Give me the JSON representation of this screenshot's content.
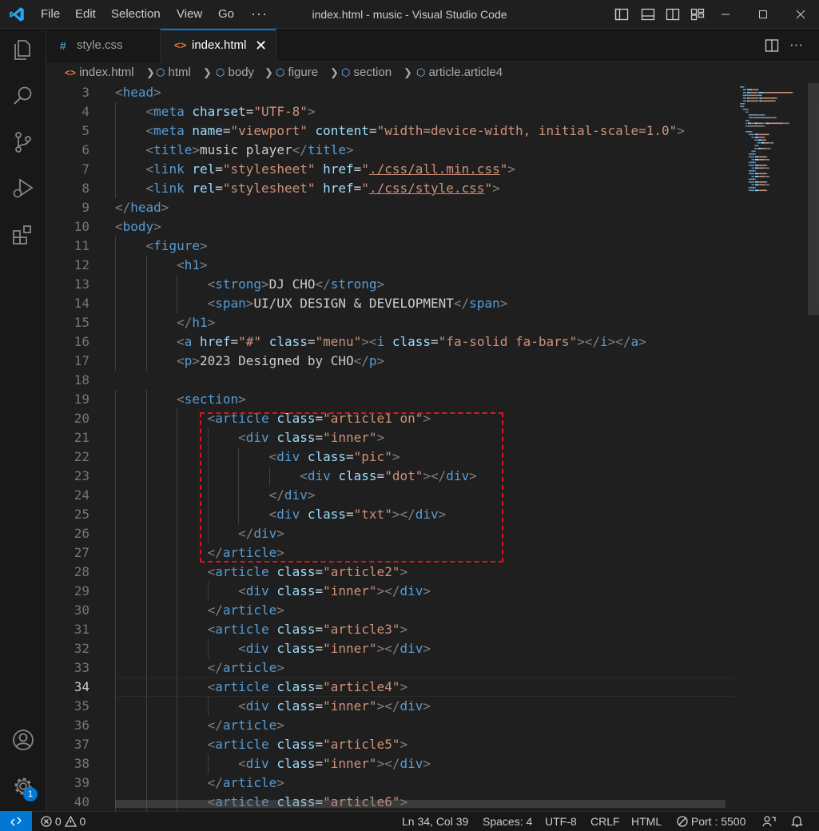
{
  "titlebar": {
    "menu": [
      "File",
      "Edit",
      "Selection",
      "View",
      "Go"
    ],
    "more": "···",
    "title": "index.html - music - Visual Studio Code"
  },
  "activity_bar": {
    "icons": [
      "explorer-icon",
      "search-icon",
      "source-control-icon",
      "run-debug-icon",
      "extensions-icon",
      "account-icon",
      "settings-gear-icon"
    ],
    "badge_count": "1",
    "accent_color": "#0078d4"
  },
  "tabs": [
    {
      "label": "style.css",
      "icon": "#",
      "active": false
    },
    {
      "label": "index.html",
      "icon": "<>",
      "active": true,
      "close": "✕"
    }
  ],
  "breadcrumb": [
    "index.html",
    "html",
    "body",
    "figure",
    "section",
    "article.article4"
  ],
  "editor": {
    "active_line": 34,
    "lines": [
      {
        "n": "3"
      },
      {
        "n": "4"
      },
      {
        "n": "5"
      },
      {
        "n": "6"
      },
      {
        "n": "7"
      },
      {
        "n": "8"
      },
      {
        "n": "9"
      },
      {
        "n": "10"
      },
      {
        "n": "11"
      },
      {
        "n": "12"
      },
      {
        "n": "13"
      },
      {
        "n": "14"
      },
      {
        "n": "15"
      },
      {
        "n": "16"
      },
      {
        "n": "17"
      },
      {
        "n": "18"
      },
      {
        "n": "19"
      },
      {
        "n": "20"
      },
      {
        "n": "21"
      },
      {
        "n": "22"
      },
      {
        "n": "23"
      },
      {
        "n": "24"
      },
      {
        "n": "25"
      },
      {
        "n": "26"
      },
      {
        "n": "27"
      },
      {
        "n": "28"
      },
      {
        "n": "29"
      },
      {
        "n": "30"
      },
      {
        "n": "31"
      },
      {
        "n": "32"
      },
      {
        "n": "33"
      },
      {
        "n": "34"
      },
      {
        "n": "35"
      },
      {
        "n": "36"
      },
      {
        "n": "37"
      },
      {
        "n": "38"
      },
      {
        "n": "39"
      },
      {
        "n": "40"
      }
    ],
    "code": [
      [
        [
          "p",
          "<"
        ],
        [
          "t",
          "head"
        ],
        [
          "p",
          ">"
        ]
      ],
      [
        [
          "x",
          "    "
        ],
        [
          "p",
          "<"
        ],
        [
          "t",
          "meta"
        ],
        [
          "x",
          " "
        ],
        [
          "a",
          "charset"
        ],
        [
          "x",
          "="
        ],
        [
          "s",
          "\"UTF-8\""
        ],
        [
          "p",
          ">"
        ]
      ],
      [
        [
          "x",
          "    "
        ],
        [
          "p",
          "<"
        ],
        [
          "t",
          "meta"
        ],
        [
          "x",
          " "
        ],
        [
          "a",
          "name"
        ],
        [
          "x",
          "="
        ],
        [
          "s",
          "\"viewport\""
        ],
        [
          "x",
          " "
        ],
        [
          "a",
          "content"
        ],
        [
          "x",
          "="
        ],
        [
          "s",
          "\"width=device-width, initial-scale=1.0\""
        ],
        [
          "p",
          ">"
        ]
      ],
      [
        [
          "x",
          "    "
        ],
        [
          "p",
          "<"
        ],
        [
          "t",
          "title"
        ],
        [
          "p",
          ">"
        ],
        [
          "x",
          "music player"
        ],
        [
          "p",
          "</"
        ],
        [
          "t",
          "title"
        ],
        [
          "p",
          ">"
        ]
      ],
      [
        [
          "x",
          "    "
        ],
        [
          "p",
          "<"
        ],
        [
          "t",
          "link"
        ],
        [
          "x",
          " "
        ],
        [
          "a",
          "rel"
        ],
        [
          "x",
          "="
        ],
        [
          "s",
          "\"stylesheet\""
        ],
        [
          "x",
          " "
        ],
        [
          "a",
          "href"
        ],
        [
          "x",
          "="
        ],
        [
          "s",
          "\""
        ],
        [
          "u",
          "./css/all.min.css"
        ],
        [
          "s",
          "\""
        ],
        [
          "p",
          ">"
        ]
      ],
      [
        [
          "x",
          "    "
        ],
        [
          "p",
          "<"
        ],
        [
          "t",
          "link"
        ],
        [
          "x",
          " "
        ],
        [
          "a",
          "rel"
        ],
        [
          "x",
          "="
        ],
        [
          "s",
          "\"stylesheet\""
        ],
        [
          "x",
          " "
        ],
        [
          "a",
          "href"
        ],
        [
          "x",
          "="
        ],
        [
          "s",
          "\""
        ],
        [
          "u",
          "./css/style.css"
        ],
        [
          "s",
          "\""
        ],
        [
          "p",
          ">"
        ]
      ],
      [
        [
          "p",
          "</"
        ],
        [
          "t",
          "head"
        ],
        [
          "p",
          ">"
        ]
      ],
      [
        [
          "p",
          "<"
        ],
        [
          "t",
          "body"
        ],
        [
          "p",
          ">"
        ]
      ],
      [
        [
          "x",
          "    "
        ],
        [
          "p",
          "<"
        ],
        [
          "t",
          "figure"
        ],
        [
          "p",
          ">"
        ]
      ],
      [
        [
          "x",
          "        "
        ],
        [
          "p",
          "<"
        ],
        [
          "t",
          "h1"
        ],
        [
          "p",
          ">"
        ]
      ],
      [
        [
          "x",
          "            "
        ],
        [
          "p",
          "<"
        ],
        [
          "t",
          "strong"
        ],
        [
          "p",
          ">"
        ],
        [
          "x",
          "DJ CHO"
        ],
        [
          "p",
          "</"
        ],
        [
          "t",
          "strong"
        ],
        [
          "p",
          ">"
        ]
      ],
      [
        [
          "x",
          "            "
        ],
        [
          "p",
          "<"
        ],
        [
          "t",
          "span"
        ],
        [
          "p",
          ">"
        ],
        [
          "x",
          "UI/UX DESIGN & DEVELOPMENT"
        ],
        [
          "p",
          "</"
        ],
        [
          "t",
          "span"
        ],
        [
          "p",
          ">"
        ]
      ],
      [
        [
          "x",
          "        "
        ],
        [
          "p",
          "</"
        ],
        [
          "t",
          "h1"
        ],
        [
          "p",
          ">"
        ]
      ],
      [
        [
          "x",
          "        "
        ],
        [
          "p",
          "<"
        ],
        [
          "t",
          "a"
        ],
        [
          "x",
          " "
        ],
        [
          "a",
          "href"
        ],
        [
          "x",
          "="
        ],
        [
          "s",
          "\"#\""
        ],
        [
          "x",
          " "
        ],
        [
          "a",
          "class"
        ],
        [
          "x",
          "="
        ],
        [
          "s",
          "\"menu\""
        ],
        [
          "p",
          ">"
        ],
        [
          "p",
          "<"
        ],
        [
          "t",
          "i"
        ],
        [
          "x",
          " "
        ],
        [
          "a",
          "class"
        ],
        [
          "x",
          "="
        ],
        [
          "s",
          "\"fa-solid fa-bars\""
        ],
        [
          "p",
          ">"
        ],
        [
          "p",
          "</"
        ],
        [
          "t",
          "i"
        ],
        [
          "p",
          ">"
        ],
        [
          "p",
          "</"
        ],
        [
          "t",
          "a"
        ],
        [
          "p",
          ">"
        ]
      ],
      [
        [
          "x",
          "        "
        ],
        [
          "p",
          "<"
        ],
        [
          "t",
          "p"
        ],
        [
          "p",
          ">"
        ],
        [
          "x",
          "2023 Designed by CHO"
        ],
        [
          "p",
          "</"
        ],
        [
          "t",
          "p"
        ],
        [
          "p",
          ">"
        ]
      ],
      [],
      [
        [
          "x",
          "        "
        ],
        [
          "p",
          "<"
        ],
        [
          "t",
          "section"
        ],
        [
          "p",
          ">"
        ]
      ],
      [
        [
          "x",
          "            "
        ],
        [
          "p",
          "<"
        ],
        [
          "t",
          "article"
        ],
        [
          "x",
          " "
        ],
        [
          "a",
          "class"
        ],
        [
          "x",
          "="
        ],
        [
          "s",
          "\"article1 on\""
        ],
        [
          "p",
          ">"
        ]
      ],
      [
        [
          "x",
          "                "
        ],
        [
          "p",
          "<"
        ],
        [
          "t",
          "div"
        ],
        [
          "x",
          " "
        ],
        [
          "a",
          "class"
        ],
        [
          "x",
          "="
        ],
        [
          "s",
          "\"inner\""
        ],
        [
          "p",
          ">"
        ]
      ],
      [
        [
          "x",
          "                    "
        ],
        [
          "p",
          "<"
        ],
        [
          "t",
          "div"
        ],
        [
          "x",
          " "
        ],
        [
          "a",
          "class"
        ],
        [
          "x",
          "="
        ],
        [
          "s",
          "\"pic\""
        ],
        [
          "p",
          ">"
        ]
      ],
      [
        [
          "x",
          "                        "
        ],
        [
          "p",
          "<"
        ],
        [
          "t",
          "div"
        ],
        [
          "x",
          " "
        ],
        [
          "a",
          "class"
        ],
        [
          "x",
          "="
        ],
        [
          "s",
          "\"dot\""
        ],
        [
          "p",
          ">"
        ],
        [
          "p",
          "</"
        ],
        [
          "t",
          "div"
        ],
        [
          "p",
          ">"
        ]
      ],
      [
        [
          "x",
          "                    "
        ],
        [
          "p",
          "</"
        ],
        [
          "t",
          "div"
        ],
        [
          "p",
          ">"
        ]
      ],
      [
        [
          "x",
          "                    "
        ],
        [
          "p",
          "<"
        ],
        [
          "t",
          "div"
        ],
        [
          "x",
          " "
        ],
        [
          "a",
          "class"
        ],
        [
          "x",
          "="
        ],
        [
          "s",
          "\"txt\""
        ],
        [
          "p",
          ">"
        ],
        [
          "p",
          "</"
        ],
        [
          "t",
          "div"
        ],
        [
          "p",
          ">"
        ]
      ],
      [
        [
          "x",
          "                "
        ],
        [
          "p",
          "</"
        ],
        [
          "t",
          "div"
        ],
        [
          "p",
          ">"
        ]
      ],
      [
        [
          "x",
          "            "
        ],
        [
          "p",
          "</"
        ],
        [
          "t",
          "article"
        ],
        [
          "p",
          ">"
        ]
      ],
      [
        [
          "x",
          "            "
        ],
        [
          "p",
          "<"
        ],
        [
          "t",
          "article"
        ],
        [
          "x",
          " "
        ],
        [
          "a",
          "class"
        ],
        [
          "x",
          "="
        ],
        [
          "s",
          "\"article2\""
        ],
        [
          "p",
          ">"
        ]
      ],
      [
        [
          "x",
          "                "
        ],
        [
          "p",
          "<"
        ],
        [
          "t",
          "div"
        ],
        [
          "x",
          " "
        ],
        [
          "a",
          "class"
        ],
        [
          "x",
          "="
        ],
        [
          "s",
          "\"inner\""
        ],
        [
          "p",
          ">"
        ],
        [
          "p",
          "</"
        ],
        [
          "t",
          "div"
        ],
        [
          "p",
          ">"
        ]
      ],
      [
        [
          "x",
          "            "
        ],
        [
          "p",
          "</"
        ],
        [
          "t",
          "article"
        ],
        [
          "p",
          ">"
        ]
      ],
      [
        [
          "x",
          "            "
        ],
        [
          "p",
          "<"
        ],
        [
          "t",
          "article"
        ],
        [
          "x",
          " "
        ],
        [
          "a",
          "class"
        ],
        [
          "x",
          "="
        ],
        [
          "s",
          "\"article3\""
        ],
        [
          "p",
          ">"
        ]
      ],
      [
        [
          "x",
          "                "
        ],
        [
          "p",
          "<"
        ],
        [
          "t",
          "div"
        ],
        [
          "x",
          " "
        ],
        [
          "a",
          "class"
        ],
        [
          "x",
          "="
        ],
        [
          "s",
          "\"inner\""
        ],
        [
          "p",
          ">"
        ],
        [
          "p",
          "</"
        ],
        [
          "t",
          "div"
        ],
        [
          "p",
          ">"
        ]
      ],
      [
        [
          "x",
          "            "
        ],
        [
          "p",
          "</"
        ],
        [
          "t",
          "article"
        ],
        [
          "p",
          ">"
        ]
      ],
      [
        [
          "x",
          "            "
        ],
        [
          "p",
          "<"
        ],
        [
          "t",
          "article"
        ],
        [
          "x",
          " "
        ],
        [
          "a",
          "class"
        ],
        [
          "x",
          "="
        ],
        [
          "s",
          "\"article4\""
        ],
        [
          "p",
          ">"
        ]
      ],
      [
        [
          "x",
          "                "
        ],
        [
          "p",
          "<"
        ],
        [
          "t",
          "div"
        ],
        [
          "x",
          " "
        ],
        [
          "a",
          "class"
        ],
        [
          "x",
          "="
        ],
        [
          "s",
          "\"inner\""
        ],
        [
          "p",
          ">"
        ],
        [
          "p",
          "</"
        ],
        [
          "t",
          "div"
        ],
        [
          "p",
          ">"
        ]
      ],
      [
        [
          "x",
          "            "
        ],
        [
          "p",
          "</"
        ],
        [
          "t",
          "article"
        ],
        [
          "p",
          ">"
        ]
      ],
      [
        [
          "x",
          "            "
        ],
        [
          "p",
          "<"
        ],
        [
          "t",
          "article"
        ],
        [
          "x",
          " "
        ],
        [
          "a",
          "class"
        ],
        [
          "x",
          "="
        ],
        [
          "s",
          "\"article5\""
        ],
        [
          "p",
          ">"
        ]
      ],
      [
        [
          "x",
          "                "
        ],
        [
          "p",
          "<"
        ],
        [
          "t",
          "div"
        ],
        [
          "x",
          " "
        ],
        [
          "a",
          "class"
        ],
        [
          "x",
          "="
        ],
        [
          "s",
          "\"inner\""
        ],
        [
          "p",
          ">"
        ],
        [
          "p",
          "</"
        ],
        [
          "t",
          "div"
        ],
        [
          "p",
          ">"
        ]
      ],
      [
        [
          "x",
          "            "
        ],
        [
          "p",
          "</"
        ],
        [
          "t",
          "article"
        ],
        [
          "p",
          ">"
        ]
      ],
      [
        [
          "x",
          "            "
        ],
        [
          "p",
          "<"
        ],
        [
          "t",
          "article"
        ],
        [
          "x",
          " "
        ],
        [
          "a",
          "class"
        ],
        [
          "x",
          "="
        ],
        [
          "s",
          "\"article6\""
        ],
        [
          "p",
          ">"
        ]
      ]
    ],
    "token_colors": {
      "tag": "#569cd6",
      "attribute": "#9cdcfe",
      "string": "#ce9178",
      "punctuation": "#808080",
      "text": "#cccccc"
    },
    "highlight_color": "#e0141e"
  },
  "statusbar": {
    "errors": "0",
    "warnings": "0",
    "position": "Ln 34, Col 39",
    "spaces": "Spaces: 4",
    "encoding": "UTF-8",
    "eol": "CRLF",
    "language": "HTML",
    "port": "Port : 5500"
  }
}
